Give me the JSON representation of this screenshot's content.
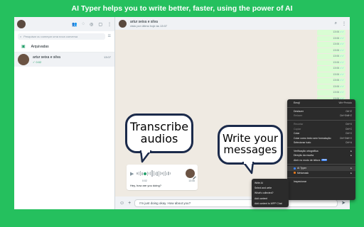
{
  "banner": "AI Typer helps you to write better, faster, using the power of AI",
  "sidebar": {
    "search_placeholder": "Pesquisar ou começar uma nova conversa",
    "archived_label": "Arquivadas",
    "chats": [
      {
        "name": "artur seixa e silva",
        "last": "✓ 0:02",
        "time": "13:07"
      }
    ]
  },
  "main": {
    "contact_name": "artur seixa e silva",
    "contact_status": "visto por último hoje às 13:07",
    "bubble_time": "13:06",
    "bubble_count": 20,
    "audio": {
      "duration": "0:02",
      "time": "13:06",
      "caption": "Hey, how are you doing?"
    },
    "input_text": "I'm just doing okay. How about you?"
  },
  "clouds": {
    "transcribe": [
      "Transcribe",
      "audios"
    ],
    "write": [
      "Write your",
      "messages"
    ]
  },
  "context_menu": [
    {
      "label": "Emoji",
      "shortcut": "Win+Período",
      "dim": false
    },
    {
      "sep": true
    },
    {
      "label": "Desfazer",
      "shortcut": "Ctrl+Z",
      "dim": false
    },
    {
      "label": "Refazer",
      "shortcut": "Ctrl+Shift+Z",
      "dim": true
    },
    {
      "sep": true
    },
    {
      "label": "Recortar",
      "shortcut": "Ctrl+X",
      "dim": true
    },
    {
      "label": "Copiar",
      "shortcut": "Ctrl+C",
      "dim": true
    },
    {
      "label": "Colar",
      "shortcut": "Ctrl+V",
      "dim": false
    },
    {
      "label": "Colar como texto sem formatação",
      "shortcut": "Ctrl+Shift+V",
      "dim": false
    },
    {
      "label": "Selecionar tudo",
      "shortcut": "Ctrl+A",
      "dim": false
    },
    {
      "sep": true
    },
    {
      "label": "Verificação ortográfica",
      "arrow": true,
      "dim": false
    },
    {
      "label": "Direção da escrita",
      "arrow": true,
      "dim": false
    },
    {
      "label": "Abrir no modo de leitura",
      "badge": "NEW",
      "dim": false
    },
    {
      "sep": true
    },
    {
      "label": "AI Typer",
      "arrow": true,
      "icon": "#3b82f6",
      "highlight": true,
      "dim": false
    },
    {
      "label": "Metamask",
      "arrow": true,
      "icon": "#e2761b",
      "dim": false
    },
    {
      "sep": true
    },
    {
      "label": "Inspecionar",
      "dim": false
    }
  ],
  "submenu": [
    "Write AI",
    "Select and write",
    "What's collected?",
    "Add content",
    "Add content to WPP Chat"
  ]
}
